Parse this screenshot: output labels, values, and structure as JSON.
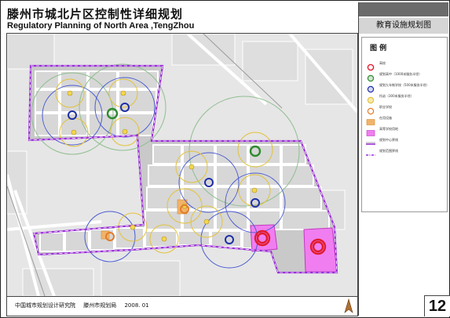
{
  "title": {
    "cn": "滕州市城北片区控制性详细规划",
    "en": "Regulatory Planning of North Area ,TengZhou"
  },
  "panel": {
    "title": "教育设施规划图"
  },
  "legend": {
    "title": "图 例",
    "items": [
      {
        "label": "高校",
        "symbol": "red-ring-icon"
      },
      {
        "label": "规划高中（1000米服务半径）",
        "symbol": "green-circle-icon"
      },
      {
        "label": "规划九年制学校（500米服务半径）",
        "symbol": "blue-circle-icon"
      },
      {
        "label": "托幼（300米服务半径）",
        "symbol": "yellow-circle-icon"
      },
      {
        "label": "职业学校",
        "symbol": "orange-circle-icon"
      },
      {
        "label": "在用设施",
        "symbol": "orange-fill-icon"
      },
      {
        "label": "高等学校用地",
        "symbol": "magenta-fill-icon"
      },
      {
        "label": "规划中心界线",
        "symbol": "purple-line-icon"
      },
      {
        "label": "规划范围界线",
        "symbol": "dashdot-line-icon"
      }
    ]
  },
  "footer": {
    "institute": "中国城市规划设计研究院",
    "bureau": "滕州市规划局",
    "date": "2008. 01"
  },
  "page_number": "12",
  "colors": {
    "boundary": "#9a2fd6",
    "university": "#e21b2c",
    "high_school": "#2e8b2e",
    "nine_year_school": "#1f2fa8",
    "kindergarten": "#e3c23a",
    "vocational": "#e37b2a",
    "university_land": "#f07ef0",
    "road": "#ffffff",
    "block": "#d6d6d6"
  }
}
